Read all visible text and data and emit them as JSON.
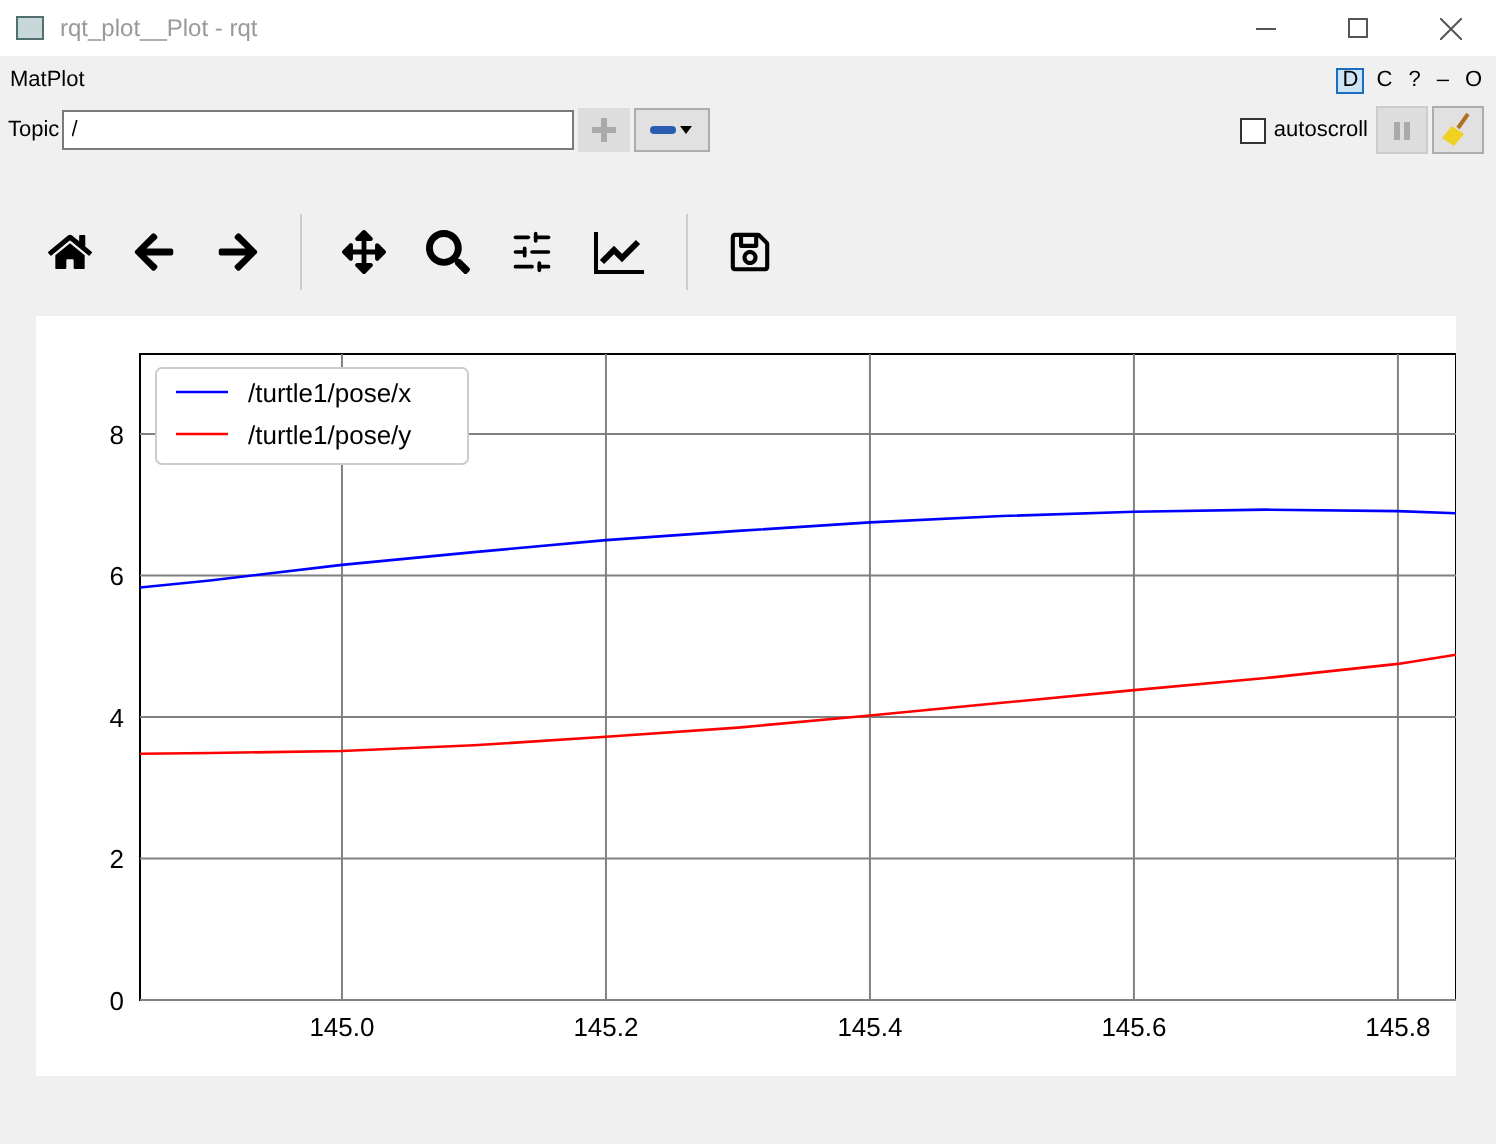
{
  "window": {
    "title": "rqt_plot__Plot - rqt"
  },
  "plugin": {
    "title": "MatPlot",
    "dock_buttons": [
      "D",
      "C",
      "?",
      "–",
      "O"
    ]
  },
  "topic": {
    "label": "Topic",
    "value": "/"
  },
  "autoscroll": {
    "label": "autoscroll",
    "checked": false
  },
  "chart_data": {
    "type": "line",
    "x": [
      144.847,
      144.9,
      145.0,
      145.1,
      145.2,
      145.3,
      145.4,
      145.5,
      145.6,
      145.7,
      145.8,
      145.844
    ],
    "series": [
      {
        "name": "/turtle1/pose/x",
        "color": "#0000ff",
        "values": [
          5.83,
          5.93,
          6.15,
          6.33,
          6.5,
          6.63,
          6.75,
          6.84,
          6.9,
          6.93,
          6.91,
          6.88
        ]
      },
      {
        "name": "/turtle1/pose/y",
        "color": "#ff0000",
        "values": [
          3.48,
          3.49,
          3.52,
          3.6,
          3.72,
          3.85,
          4.02,
          4.2,
          4.38,
          4.55,
          4.75,
          4.88
        ]
      }
    ],
    "grid": true,
    "legend": true,
    "xlim": [
      144.847,
      145.844
    ],
    "ylim": [
      0,
      9.13
    ],
    "xticks": [
      {
        "value": 145.0,
        "label": "145.0"
      },
      {
        "value": 145.2,
        "label": "145.2"
      },
      {
        "value": 145.4,
        "label": "145.4"
      },
      {
        "value": 145.6,
        "label": "145.6"
      },
      {
        "value": 145.8,
        "label": "145.8"
      }
    ],
    "yticks": [
      {
        "value": 0,
        "label": "0"
      },
      {
        "value": 2,
        "label": "2"
      },
      {
        "value": 4,
        "label": "4"
      },
      {
        "value": 6,
        "label": "6"
      },
      {
        "value": 8,
        "label": "8"
      }
    ]
  }
}
